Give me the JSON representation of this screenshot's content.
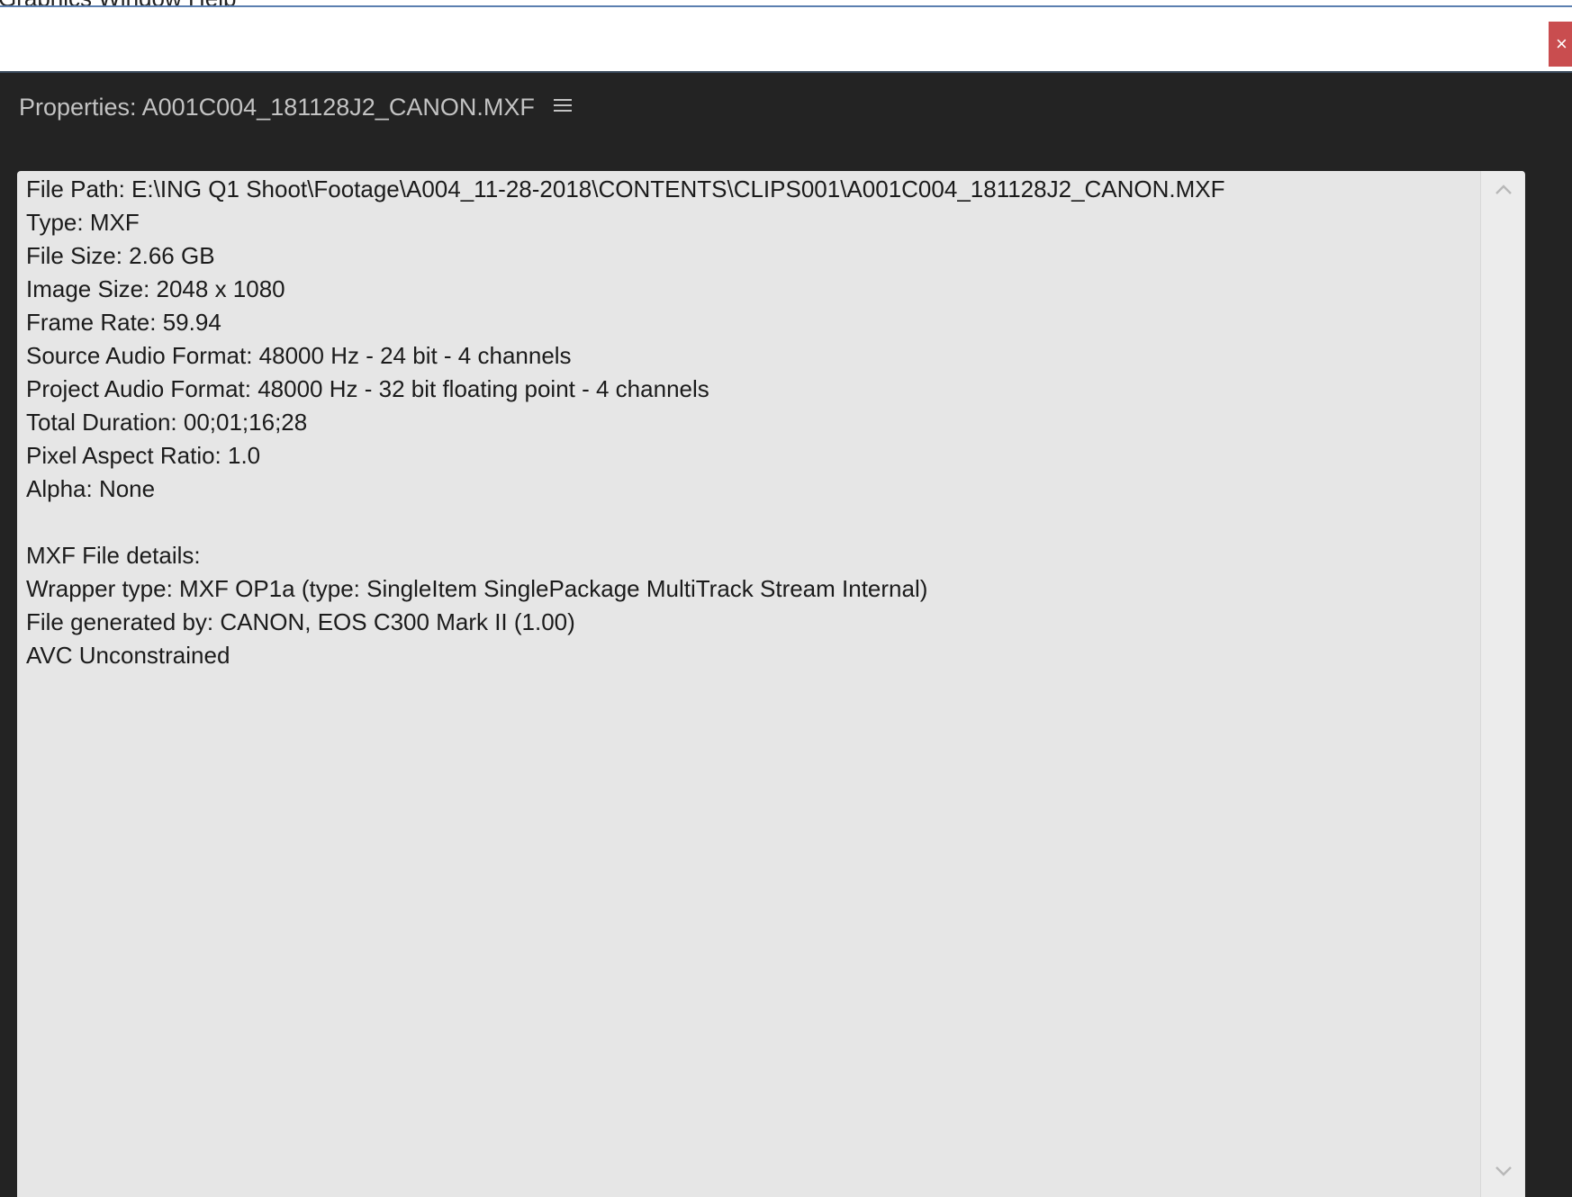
{
  "menubar": {
    "text": "Graphics Window Help"
  },
  "window": {
    "close_label": "×"
  },
  "panel": {
    "title": "Properties: A001C004_181128J2_CANON.MXF",
    "menu_icon": "hamburger-menu-icon"
  },
  "properties": {
    "lines": [
      "File Path: E:\\ING Q1 Shoot\\Footage\\A004_11-28-2018\\CONTENTS\\CLIPS001\\A001C004_181128J2_CANON.MXF",
      "Type: MXF",
      "File Size: 2.66 GB",
      "Image Size: 2048 x 1080",
      "Frame Rate: 59.94",
      "Source Audio Format: 48000 Hz - 24 bit - 4 channels",
      "Project Audio Format: 48000 Hz - 32 bit floating point - 4 channels",
      "Total Duration: 00;01;16;28",
      "Pixel Aspect Ratio: 1.0",
      "Alpha: None",
      "",
      "MXF File details:",
      "Wrapper type: MXF OP1a (type: SingleItem SinglePackage MultiTrack Stream Internal)",
      "File generated by: CANON, EOS C300 Mark II (1.00)",
      "AVC Unconstrained"
    ]
  },
  "colors": {
    "panel_bg": "#232323",
    "content_bg": "#e6e6e6",
    "close_button": "#c94d4f",
    "title_text": "#c3c3c3"
  }
}
